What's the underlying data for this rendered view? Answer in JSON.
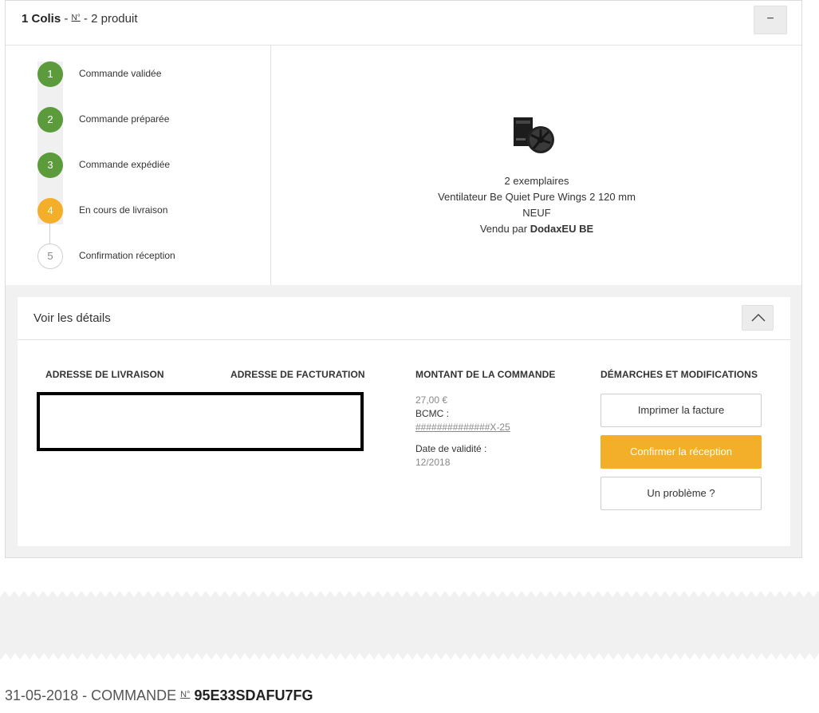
{
  "package": {
    "count_label": "1 Colis",
    "sep1": " - ",
    "number_label": "N°",
    "sep2": " - ",
    "product_count": "2 produit",
    "collapse_symbol": "−"
  },
  "steps": [
    {
      "num": "1",
      "label": "Commande validée",
      "state": "done"
    },
    {
      "num": "2",
      "label": "Commande préparée",
      "state": "done"
    },
    {
      "num": "3",
      "label": "Commande expédiée",
      "state": "done"
    },
    {
      "num": "4",
      "label": "En cours de livraison",
      "state": "active"
    },
    {
      "num": "5",
      "label": "Confirmation réception",
      "state": "todo"
    }
  ],
  "product": {
    "quantity": "2 exemplaires",
    "name": "Ventilateur Be Quiet Pure Wings 2 120 mm",
    "condition": "NEUF",
    "sold_by_prefix": "Vendu par ",
    "seller": "DodaxEU BE"
  },
  "details": {
    "title": "Voir les détails",
    "shipping_header": "ADRESSE DE LIVRAISON",
    "billing_header": "ADRESSE DE FACTURATION",
    "amount_header": "MONTANT DE LA COMMANDE",
    "actions_header": "DÉMARCHES ET MODIFICATIONS",
    "amount": "27,00 €",
    "bcmc_label": "BCMC :",
    "card_number": "##############X-25",
    "validity_label": "Date de validité :",
    "validity_value": "12/2018",
    "buttons": {
      "print": "Imprimer la facture",
      "confirm": "Confirmer la réception",
      "problem": "Un problème ?"
    }
  },
  "order": {
    "date": "31-05-2018",
    "sep": " - ",
    "label": "COMMANDE ",
    "number_label": "N°",
    "number": "95E33SDAFU7FG"
  },
  "colors": {
    "step_done": "#5b9b3c",
    "step_active": "#f3ae2a",
    "accent_button": "#f3ae2a"
  }
}
